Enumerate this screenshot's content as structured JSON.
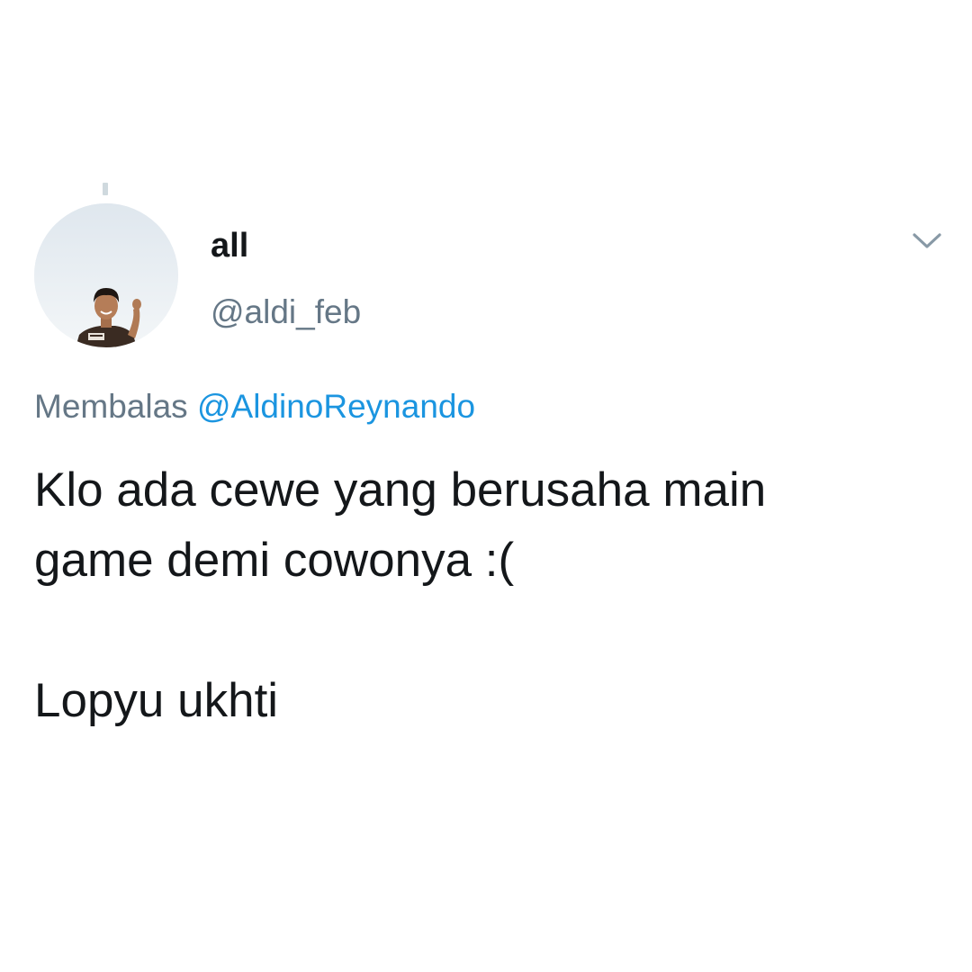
{
  "tweet": {
    "display_name": "all",
    "handle": "@aldi_feb",
    "reply_prefix": "Membalas",
    "reply_to": "@AldinoReynando",
    "text_line_1": "Klo ada cewe yang berusaha main",
    "text_line_2": "game demi cowonya :(",
    "text_line_3": "Lopyu ukhti"
  },
  "colors": {
    "text": "#14171a",
    "secondary": "#657786",
    "mention": "#1b95e0"
  },
  "icons": {
    "menu": "chevron-down-icon"
  }
}
